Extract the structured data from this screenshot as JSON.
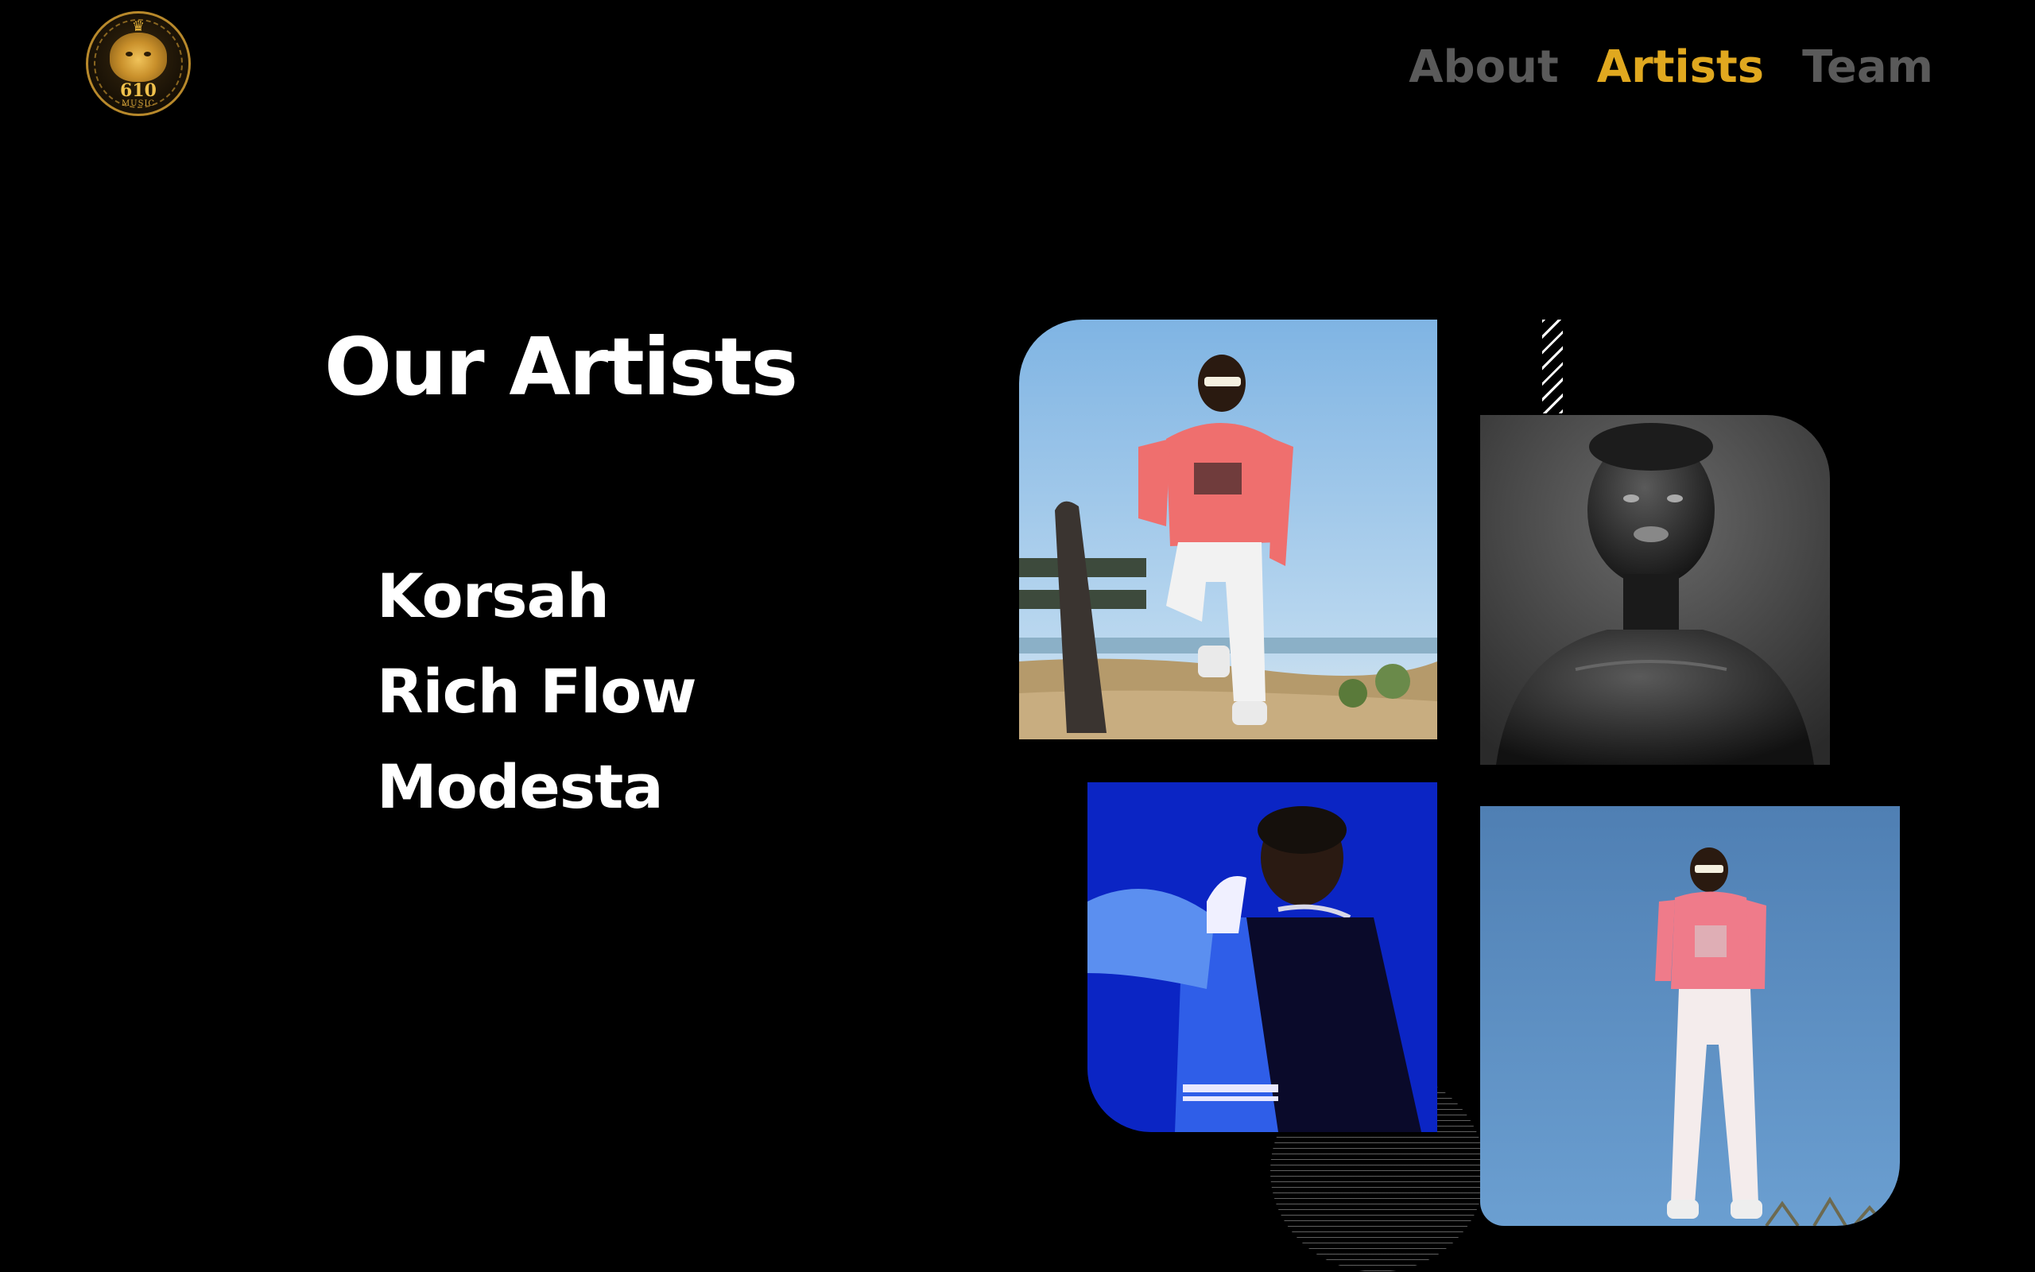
{
  "logo": {
    "number": "610",
    "subtitle": "MUSIC"
  },
  "nav": {
    "items": [
      {
        "label": "About",
        "active": false
      },
      {
        "label": "Artists",
        "active": true
      },
      {
        "label": "Team",
        "active": false
      }
    ],
    "active_color": "#e0a81f",
    "inactive_color": "#5a5a5a"
  },
  "heading": "Our Artists",
  "artists": [
    "Korsah",
    "Rich Flow",
    "Modesta"
  ],
  "colors": {
    "background": "#000000",
    "text": "#ffffff",
    "accent": "#e0a81f"
  }
}
